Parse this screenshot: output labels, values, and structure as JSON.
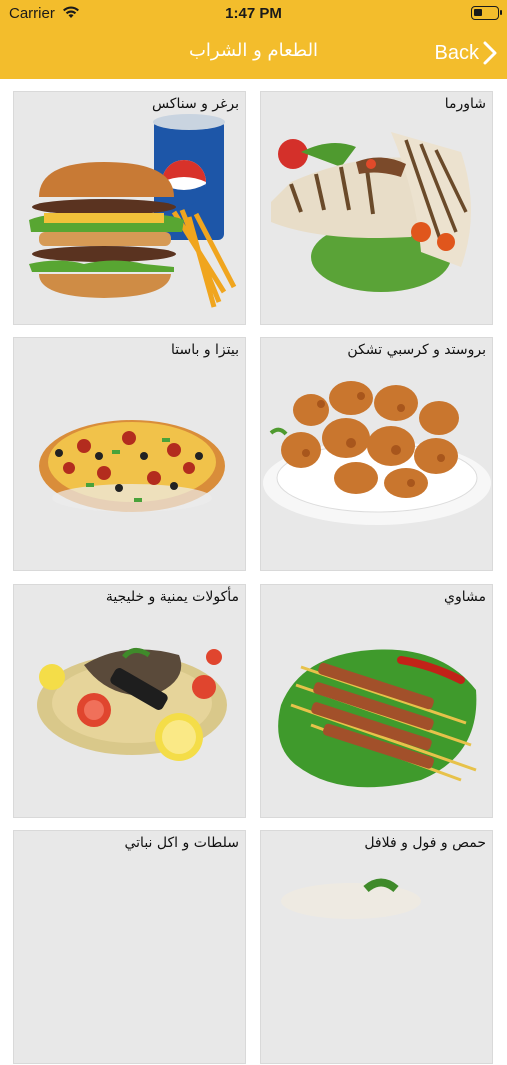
{
  "status_bar": {
    "carrier": "Carrier",
    "time": "1:47 PM"
  },
  "nav": {
    "title": "الطعام و الشراب",
    "back_label": "Back"
  },
  "categories": [
    {
      "label": "شاورما",
      "icon": "shawarma-image"
    },
    {
      "label": "برغر و سناكس",
      "icon": "burger-image"
    },
    {
      "label": "بروستد و كرسبي تشكن",
      "icon": "fried-chicken-image"
    },
    {
      "label": "بيتزا و باستا",
      "icon": "pizza-image"
    },
    {
      "label": "مشاوي",
      "icon": "grill-image"
    },
    {
      "label": "مأكولات يمنية و خليجية",
      "icon": "gulf-food-image"
    },
    {
      "label": "حمص و فول و فلافل",
      "icon": "hummus-image"
    },
    {
      "label": "سلطات و اكل نباتي",
      "icon": "salad-image"
    }
  ],
  "colors": {
    "accent": "#f3bd2c",
    "card_bg": "#e8e8e8"
  }
}
